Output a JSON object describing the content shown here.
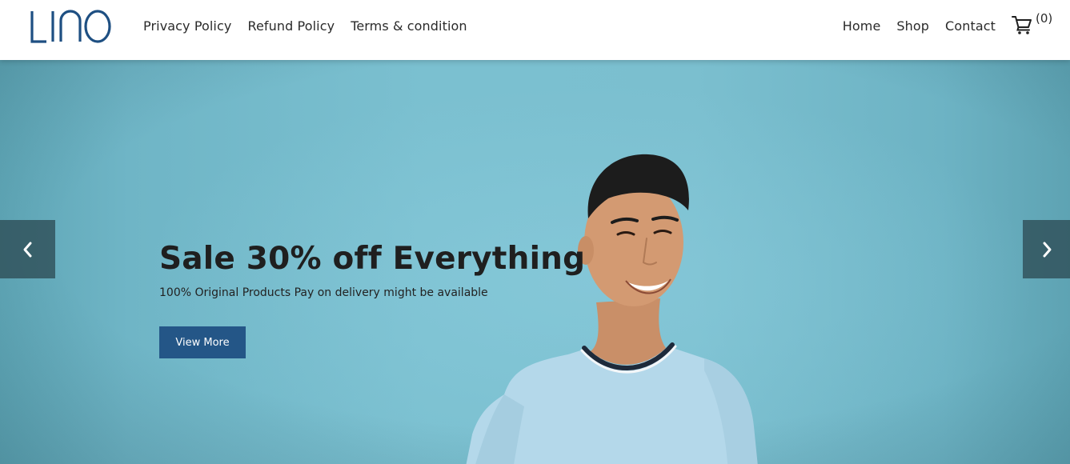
{
  "brand": {
    "logo_text": "LINO",
    "logo_color": "#1e4f82"
  },
  "nav_left": {
    "items": [
      "Privacy Policy",
      "Refund Policy",
      "Terms & condition"
    ]
  },
  "nav_right": {
    "items": [
      "Home",
      "Shop",
      "Contact"
    ]
  },
  "cart": {
    "icon": "cart-icon",
    "count_label": "(0)"
  },
  "hero": {
    "title": "Sale 30% off Everything",
    "subtitle": "100% Original Products Pay on delivery might be available",
    "button_label": "View More",
    "button_color": "#245687",
    "background_color": "#7bbfcf",
    "prev_icon": "chevron-left-icon",
    "next_icon": "chevron-right-icon"
  }
}
